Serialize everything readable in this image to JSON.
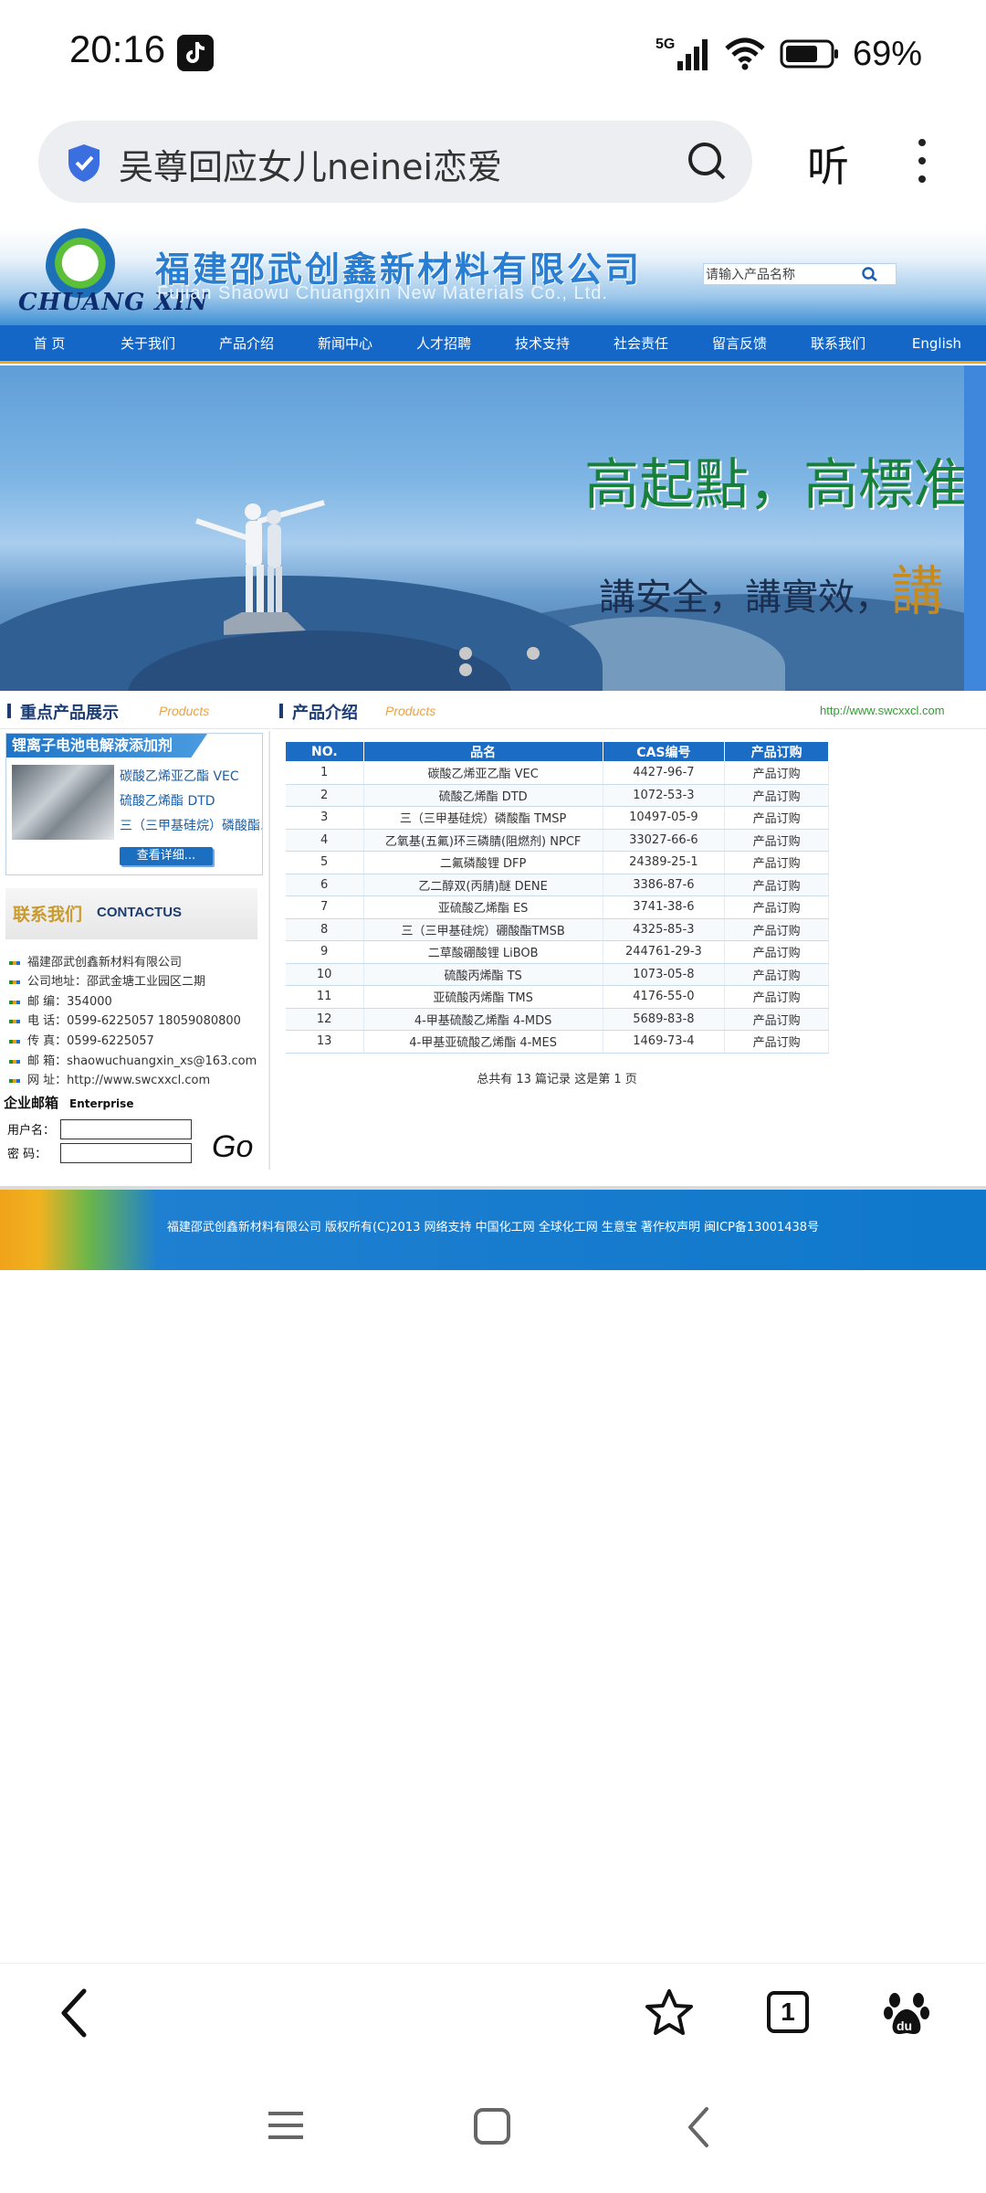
{
  "status_bar": {
    "time": "20:16",
    "network": "5G",
    "battery": "69%",
    "icons": [
      "tiktok-icon",
      "signal-icon",
      "wifi-icon",
      "battery-icon"
    ]
  },
  "address_bar": {
    "query": "吴尊回应女儿neinei恋爱",
    "listen_label": "听",
    "icons": [
      "shield-icon",
      "search-icon",
      "more-icon"
    ]
  },
  "site_header": {
    "logo_text": "CHUANG XIN",
    "company_cn": "福建邵武创鑫新材料有限公司",
    "company_en": "Fujian Shaowu Chuangxin New Materials Co., Ltd.",
    "search_placeholder": "请输入产品名称"
  },
  "nav": [
    "首 页",
    "关于我们",
    "产品介绍",
    "新闻中心",
    "人才招聘",
    "技术支持",
    "社会责任",
    "留言反馈",
    "联系我们",
    "English"
  ],
  "banner": {
    "slogan_line1": "高起點，高標准，",
    "slogan_line2": "講安全，講實效，",
    "slogan_line2_end": "講"
  },
  "featured": {
    "title": "重点产品展示",
    "subtitle": "Products",
    "tag": "锂离子电池电解液添加剂",
    "items": [
      "碳酸乙烯亚乙酯 VEC",
      "硫酸乙烯酯 DTD",
      "三（三甲基硅烷）磷酸酯..."
    ],
    "more_label": "查看详细..."
  },
  "products_section": {
    "title": "产品介绍",
    "subtitle": "Products",
    "site_url": "http://www.swcxxcl.com"
  },
  "contact": {
    "title_cn": "联系我们",
    "title_en": "CONTACTUS",
    "lines": [
      "福建邵武创鑫新材料有限公司",
      "公司地址：邵武金塘工业园区二期",
      "邮 编：354000",
      "电 话：0599-6225057  18059080800",
      "传 真：0599-6225057",
      "邮 箱：shaowuchuangxin_xs@163.com",
      "网 址：http://www.swcxxcl.com"
    ]
  },
  "mail_login": {
    "title": "企业邮箱",
    "title_en": "Enterprise",
    "username_label": "用户名：",
    "password_label": "密    码：",
    "go_label": "Go"
  },
  "product_table": {
    "headers": [
      "NO.",
      "品名",
      "CAS编号",
      "产品订购"
    ],
    "rows": [
      [
        "1",
        "碳酸乙烯亚乙酯 VEC",
        "4427-96-7",
        "产品订购"
      ],
      [
        "2",
        "硫酸乙烯酯 DTD",
        "1072-53-3",
        "产品订购"
      ],
      [
        "3",
        "三（三甲基硅烷）磷酸酯 TMSP",
        "10497-05-9",
        "产品订购"
      ],
      [
        "4",
        "乙氧基(五氟)环三磷腈(阻燃剂) NPCF",
        "33027-66-6",
        "产品订购"
      ],
      [
        "5",
        "二氟磷酸锂 DFP",
        "24389-25-1",
        "产品订购"
      ],
      [
        "6",
        "乙二醇双(丙腈)醚 DENE",
        "3386-87-6",
        "产品订购"
      ],
      [
        "7",
        "亚硫酸乙烯酯 ES",
        "3741-38-6",
        "产品订购"
      ],
      [
        "8",
        "三（三甲基硅烷）硼酸酯TMSB",
        "4325-85-3",
        "产品订购"
      ],
      [
        "9",
        "二草酸硼酸锂 LiBOB",
        "244761-29-3",
        "产品订购"
      ],
      [
        "10",
        "硫酸丙烯酯 TS",
        "1073-05-8",
        "产品订购"
      ],
      [
        "11",
        "亚硫酸丙烯酯 TMS",
        "4176-55-0",
        "产品订购"
      ],
      [
        "12",
        "4-甲基硫酸乙烯酯 4-MDS",
        "5689-83-8",
        "产品订购"
      ],
      [
        "13",
        "4-甲基亚硫酸乙烯酯 4-MES",
        "1469-73-4",
        "产品订购"
      ]
    ],
    "pager": "总共有 13 篇记录 这是第 1 页"
  },
  "footer": {
    "text": "福建邵武创鑫新材料有限公司 版权所有(C)2013  网络支持 中国化工网 全球化工网 生意宝 著作权声明 闽ICP备13001438号"
  },
  "browser_bottom": {
    "tab_count": "1",
    "icons": [
      "back-icon",
      "bookmark-star-icon",
      "tabs-icon",
      "baidu-paw-icon"
    ]
  },
  "system_nav": {
    "icons": [
      "menu-icon",
      "home-icon",
      "back-icon"
    ]
  }
}
